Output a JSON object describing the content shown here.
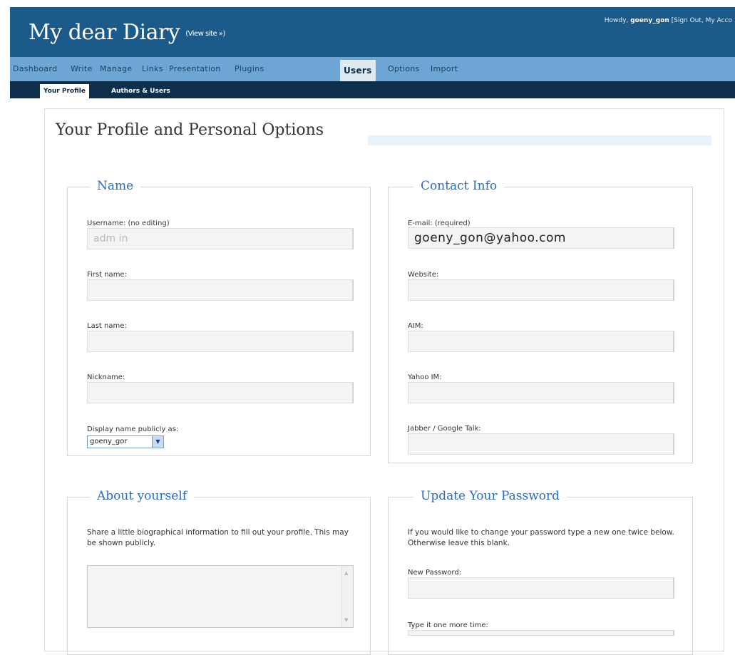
{
  "header": {
    "site_title": "My dear Diary",
    "view_site": "(View site »)",
    "howdy_prefix": "Howdy, ",
    "username": "goeny_gon",
    "howdy_links": " [Sign Out, My Acco"
  },
  "nav": {
    "items": [
      "Dashboard",
      "Write",
      "Manage",
      "Links",
      "Presentation",
      "Plugins",
      "Users",
      "Options",
      "Import"
    ],
    "active": "Users"
  },
  "subnav": {
    "items": [
      "Your Profile",
      "Authors & Users"
    ],
    "active": "Your Profile"
  },
  "page": {
    "title": "Your Profile and Personal Options"
  },
  "name_section": {
    "legend": "Name",
    "username_label": "Username: (no editing)",
    "username_value": "adm in",
    "first_name_label": "First name:",
    "last_name_label": "Last name:",
    "nickname_label": "Nickname:",
    "display_label": "Display name publicly as:",
    "display_value": "goeny_gor"
  },
  "contact_section": {
    "legend": "Contact Info",
    "email_label": "E-mail: (required)",
    "email_value": "goeny_gon@yahoo.com",
    "website_label": "Website:",
    "aim_label": "AIM:",
    "yahoo_label": "Yahoo IM:",
    "jabber_label": "Jabber / Google Talk:"
  },
  "about_section": {
    "legend": "About yourself",
    "description": "Share a little biographical information to fill out your profile. This may be shown publicly."
  },
  "password_section": {
    "legend": "Update Your Password",
    "description": "If you would like to change your password type a new one twice below. Otherwise leave this blank.",
    "new_password_label": "New Password:",
    "confirm_label": "Type it one more time:"
  },
  "icons": {
    "dropdown": "chevron-down-icon",
    "scroll_up": "scroll-up-arrow-icon",
    "scroll_down": "scroll-down-arrow-icon"
  },
  "colors": {
    "header_bg": "#1c5a8a",
    "nav_bg": "#6da6d4",
    "subnav_bg": "#0d2f4c",
    "legend_color": "#2b6cbc"
  }
}
